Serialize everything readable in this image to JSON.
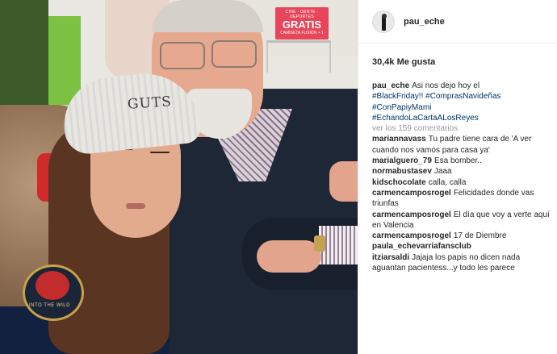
{
  "post": {
    "username": "pau_eche",
    "likes": "30,4k Me gusta"
  },
  "photo": {
    "ad_top": "CINE · GENTE · DEPORTES",
    "ad_big": "GRATIS",
    "ad_bottom": "CAMISETA FUSIÓN + 1",
    "beanie_text": "GUTS",
    "badge_text": "INTO THE WILD"
  },
  "caption": {
    "user": "pau_eche",
    "text": "Asi nos dejo hoy el",
    "hashtags": [
      "#BlackFriday!! #ComprasNavideñas",
      "#ConPapiyMami",
      "#EchandoLaCartaALosReyes"
    ]
  },
  "view_comments": "ver los 159 comentarios",
  "comments": [
    {
      "user": "mariannavass",
      "text": "Tu padre tiene cara de 'A ver cuando nos vamos para casa ya'"
    },
    {
      "user": "marialguero_79",
      "text": "Esa bomber.."
    },
    {
      "user": "normabustasev",
      "text": "Jaaa"
    },
    {
      "user": "kidschocolate",
      "text": "calla, calla"
    },
    {
      "user": "carmencamposrogel",
      "text": "Felicidades donde vas triunfas"
    },
    {
      "user": "carmencamposrogel",
      "text": "El día que voy a verte aquí en Valencia"
    },
    {
      "user": "carmencamposrogel",
      "text": "17 de Diembre"
    },
    {
      "user": "paula_echevarriafansclub",
      "text": ""
    },
    {
      "user": "itziarsaldi",
      "text": "Jajaja los papis no dicen nada aguantan pacientess...y todo les parece"
    }
  ],
  "colors": {
    "hashtag": "#003569",
    "muted": "#999999",
    "text": "#262626"
  }
}
